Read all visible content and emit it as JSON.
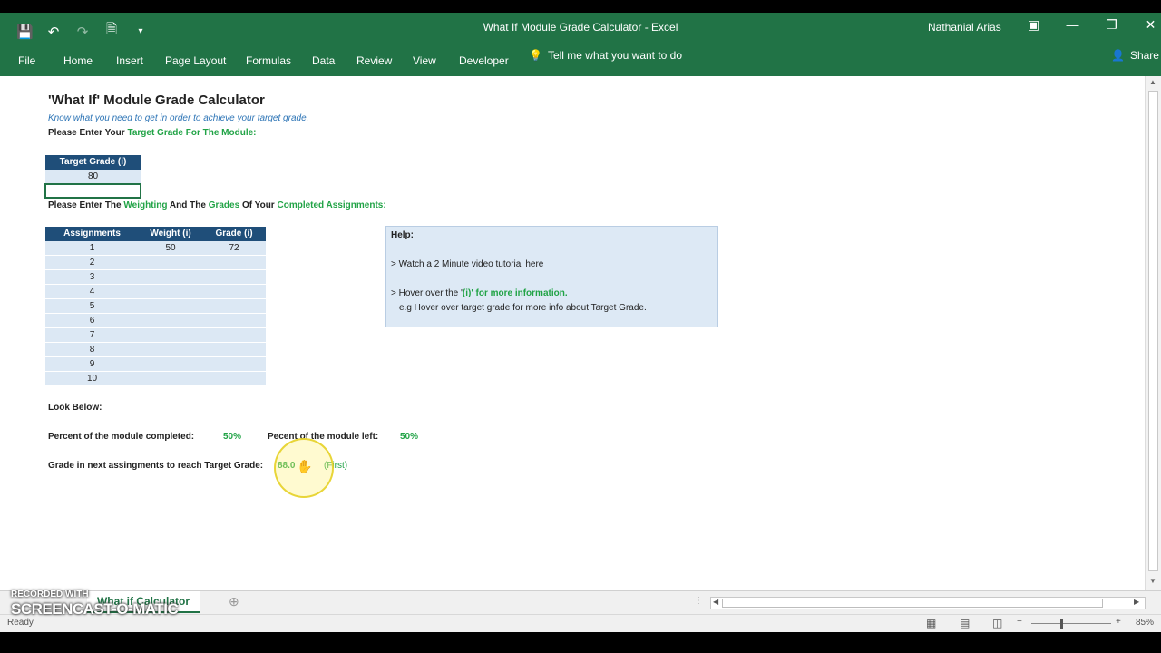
{
  "window": {
    "title": "What If Module Grade Calculator  -  Excel",
    "user": "Nathanial Arias"
  },
  "quick_access": {
    "save_icon": "save-icon",
    "undo_icon": "undo-icon",
    "redo_icon": "redo-icon",
    "customize_icon": "customize-icon"
  },
  "ribbon": {
    "tabs": [
      "File",
      "Home",
      "Insert",
      "Page Layout",
      "Formulas",
      "Data",
      "Review",
      "View",
      "Developer"
    ],
    "tell_me": "Tell me what you want to do",
    "share": "Share"
  },
  "sheet": {
    "title": "'What If' Module Grade Calculator",
    "subtitle": "Know what you need to get in order to achieve your target grade.",
    "prompt1_prefix": "Please Enter Your ",
    "prompt1_highlight": "Target Grade For The Module:",
    "target": {
      "header": "Target Grade (i)",
      "value": "80"
    },
    "prompt2": {
      "p1": "Please Enter The ",
      "h1": "Weighting",
      "p2": " And The ",
      "h2": "Grades",
      "p3": " Of Your ",
      "h3": "Completed Assignments:"
    },
    "assignments": {
      "headers": [
        "Assignments",
        "Weight (i)",
        "Grade  (i)"
      ],
      "rows": [
        [
          "1",
          "50",
          "72"
        ],
        [
          "2",
          "",
          ""
        ],
        [
          "3",
          "",
          ""
        ],
        [
          "4",
          "",
          ""
        ],
        [
          "5",
          "",
          ""
        ],
        [
          "6",
          "",
          ""
        ],
        [
          "7",
          "",
          ""
        ],
        [
          "8",
          "",
          ""
        ],
        [
          "9",
          "",
          ""
        ],
        [
          "10",
          "",
          ""
        ]
      ]
    },
    "help": {
      "title": "Help:",
      "line1": "> Watch a 2 Minute video tutorial here",
      "line2_prefix": "> Hover over the '",
      "line2_link": "(i)' for more information.",
      "line3": "e.g Hover over target grade for more info about Target Grade."
    },
    "look_below": "Look Below:",
    "completed_label": "Percent of the module completed:",
    "completed_value": "50%",
    "left_label": "Pecent of the module left:",
    "left_value": "50%",
    "next_label": "Grade in next assingments to reach Target Grade:",
    "next_value": "88.0",
    "next_class": "(First)"
  },
  "bottom": {
    "sheet_tab": "What if Calculator",
    "status": "Ready",
    "zoom": "85%",
    "watermark_top": "RECORDED WITH",
    "watermark_bottom": "SCREENCAST-O-MATIC"
  }
}
